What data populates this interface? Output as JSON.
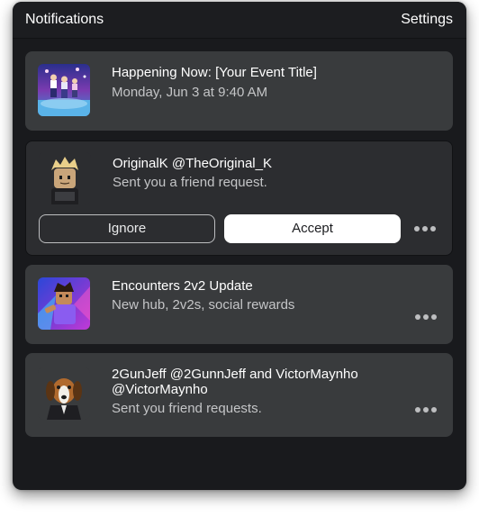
{
  "header": {
    "title": "Notifications",
    "settings_label": "Settings"
  },
  "notifications": [
    {
      "title": "Happening Now: [Your Event Title]",
      "subtitle": "Monday, Jun 3 at 9:40 AM",
      "thumbnail": "event-thumbnail"
    },
    {
      "title": "OriginalK @TheOriginal_K",
      "subtitle": "Sent you a friend request.",
      "thumbnail": "avatar-originalk",
      "ignore_label": "Ignore",
      "accept_label": "Accept"
    },
    {
      "title": "Encounters 2v2 Update",
      "subtitle": "New hub, 2v2s, social rewards",
      "thumbnail": "game-thumbnail"
    },
    {
      "title_line1": "2GunJeff @2GunnJeff  and VictorMaynho",
      "title_line2": "@VictorMaynho",
      "subtitle": "Sent you friend requests.",
      "thumbnail": "avatar-dog"
    }
  ],
  "colors": {
    "panel_bg": "#191a1d",
    "card_bg": "#393b3d",
    "selected_card_bg": "#2c2d30",
    "accept_bg": "#ffffff"
  }
}
